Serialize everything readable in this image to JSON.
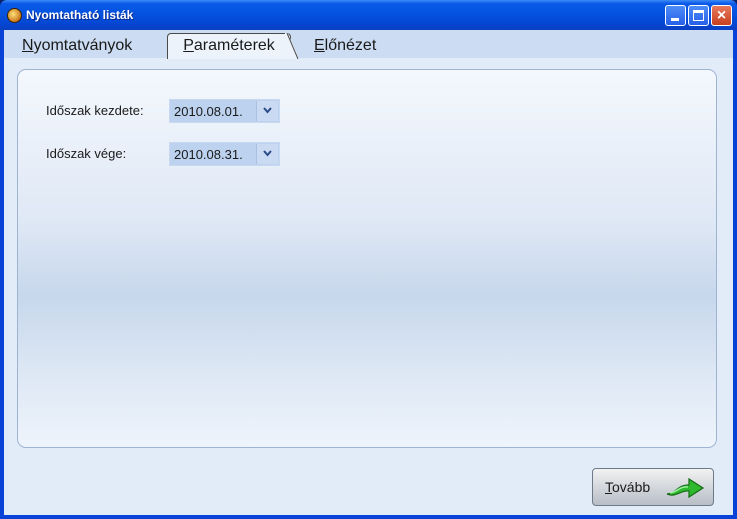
{
  "window": {
    "title": "Nyomtatható listák",
    "controls": {
      "minimize": "minimize",
      "maximize": "maximize",
      "close": "×"
    }
  },
  "tabs": [
    {
      "label_u": "N",
      "label_rest": "yomtatványok",
      "selected": false
    },
    {
      "label_u": "P",
      "label_rest": "araméterek",
      "selected": true
    },
    {
      "label_u": "E",
      "label_rest": "lőnézet",
      "selected": false
    }
  ],
  "params": {
    "start_label": "Időszak kezdete:",
    "start_value": "2010.08.01.",
    "end_label": "Időszak vége:",
    "end_value": "2010.08.31."
  },
  "footer": {
    "next_u": "T",
    "next_rest": "ovább"
  },
  "colors": {
    "titlebar": "#0552e0",
    "client_bg": "#e2ecf8",
    "date_bg": "#bcd2ef",
    "arrow_green": "#2eb82e"
  }
}
